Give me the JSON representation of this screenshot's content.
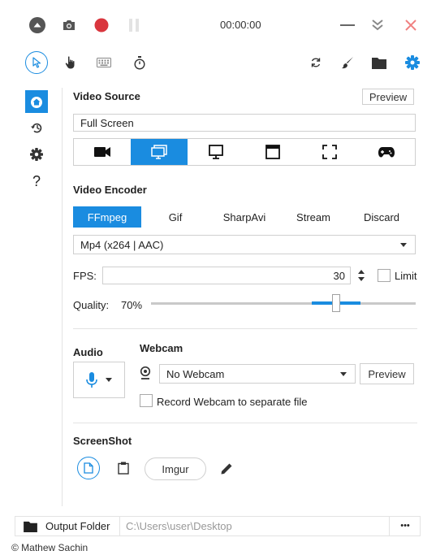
{
  "titlebar": {
    "timer": "00:00:00"
  },
  "colors": {
    "accent": "#1a8ce0",
    "record": "#d9363e",
    "close": "#f08080"
  },
  "toolbar": {
    "tools": [
      "cursor-icon",
      "hand-icon",
      "keyboard-icon",
      "stopwatch-icon"
    ],
    "right": [
      "refresh-icon",
      "brush-icon",
      "folder-icon",
      "settings-icon"
    ]
  },
  "sidebar": {
    "items": [
      "home-icon",
      "history-icon",
      "settings-icon",
      "help-icon"
    ],
    "help_label": "?"
  },
  "video_source": {
    "heading": "Video Source",
    "preview_label": "Preview",
    "source_value": "Full Screen",
    "sources": [
      "camera-icon",
      "screen-icon",
      "monitor-icon",
      "window-icon",
      "region-icon",
      "gamepad-icon"
    ],
    "active_index": 1
  },
  "video_encoder": {
    "heading": "Video Encoder",
    "tabs": [
      "FFmpeg",
      "Gif",
      "SharpAvi",
      "Stream",
      "Discard"
    ],
    "active_index": 0,
    "format_value": "Mp4 (x264 | AAC)",
    "fps_label": "FPS:",
    "fps_value": "30",
    "limit_label": "Limit",
    "quality_label": "Quality:",
    "quality_value": "70%",
    "quality_level": 0.7
  },
  "audio": {
    "heading": "Audio"
  },
  "webcam": {
    "heading": "Webcam",
    "value": "No Webcam",
    "preview_label": "Preview",
    "separate_file_label": "Record Webcam to separate file"
  },
  "screenshot": {
    "heading": "ScreenShot",
    "imgur_label": "Imgur"
  },
  "footer": {
    "output_folder_label": "Output Folder",
    "output_path": "C:\\Users\\user\\Desktop",
    "more_label": "•••",
    "copyright": "© Mathew Sachin"
  }
}
